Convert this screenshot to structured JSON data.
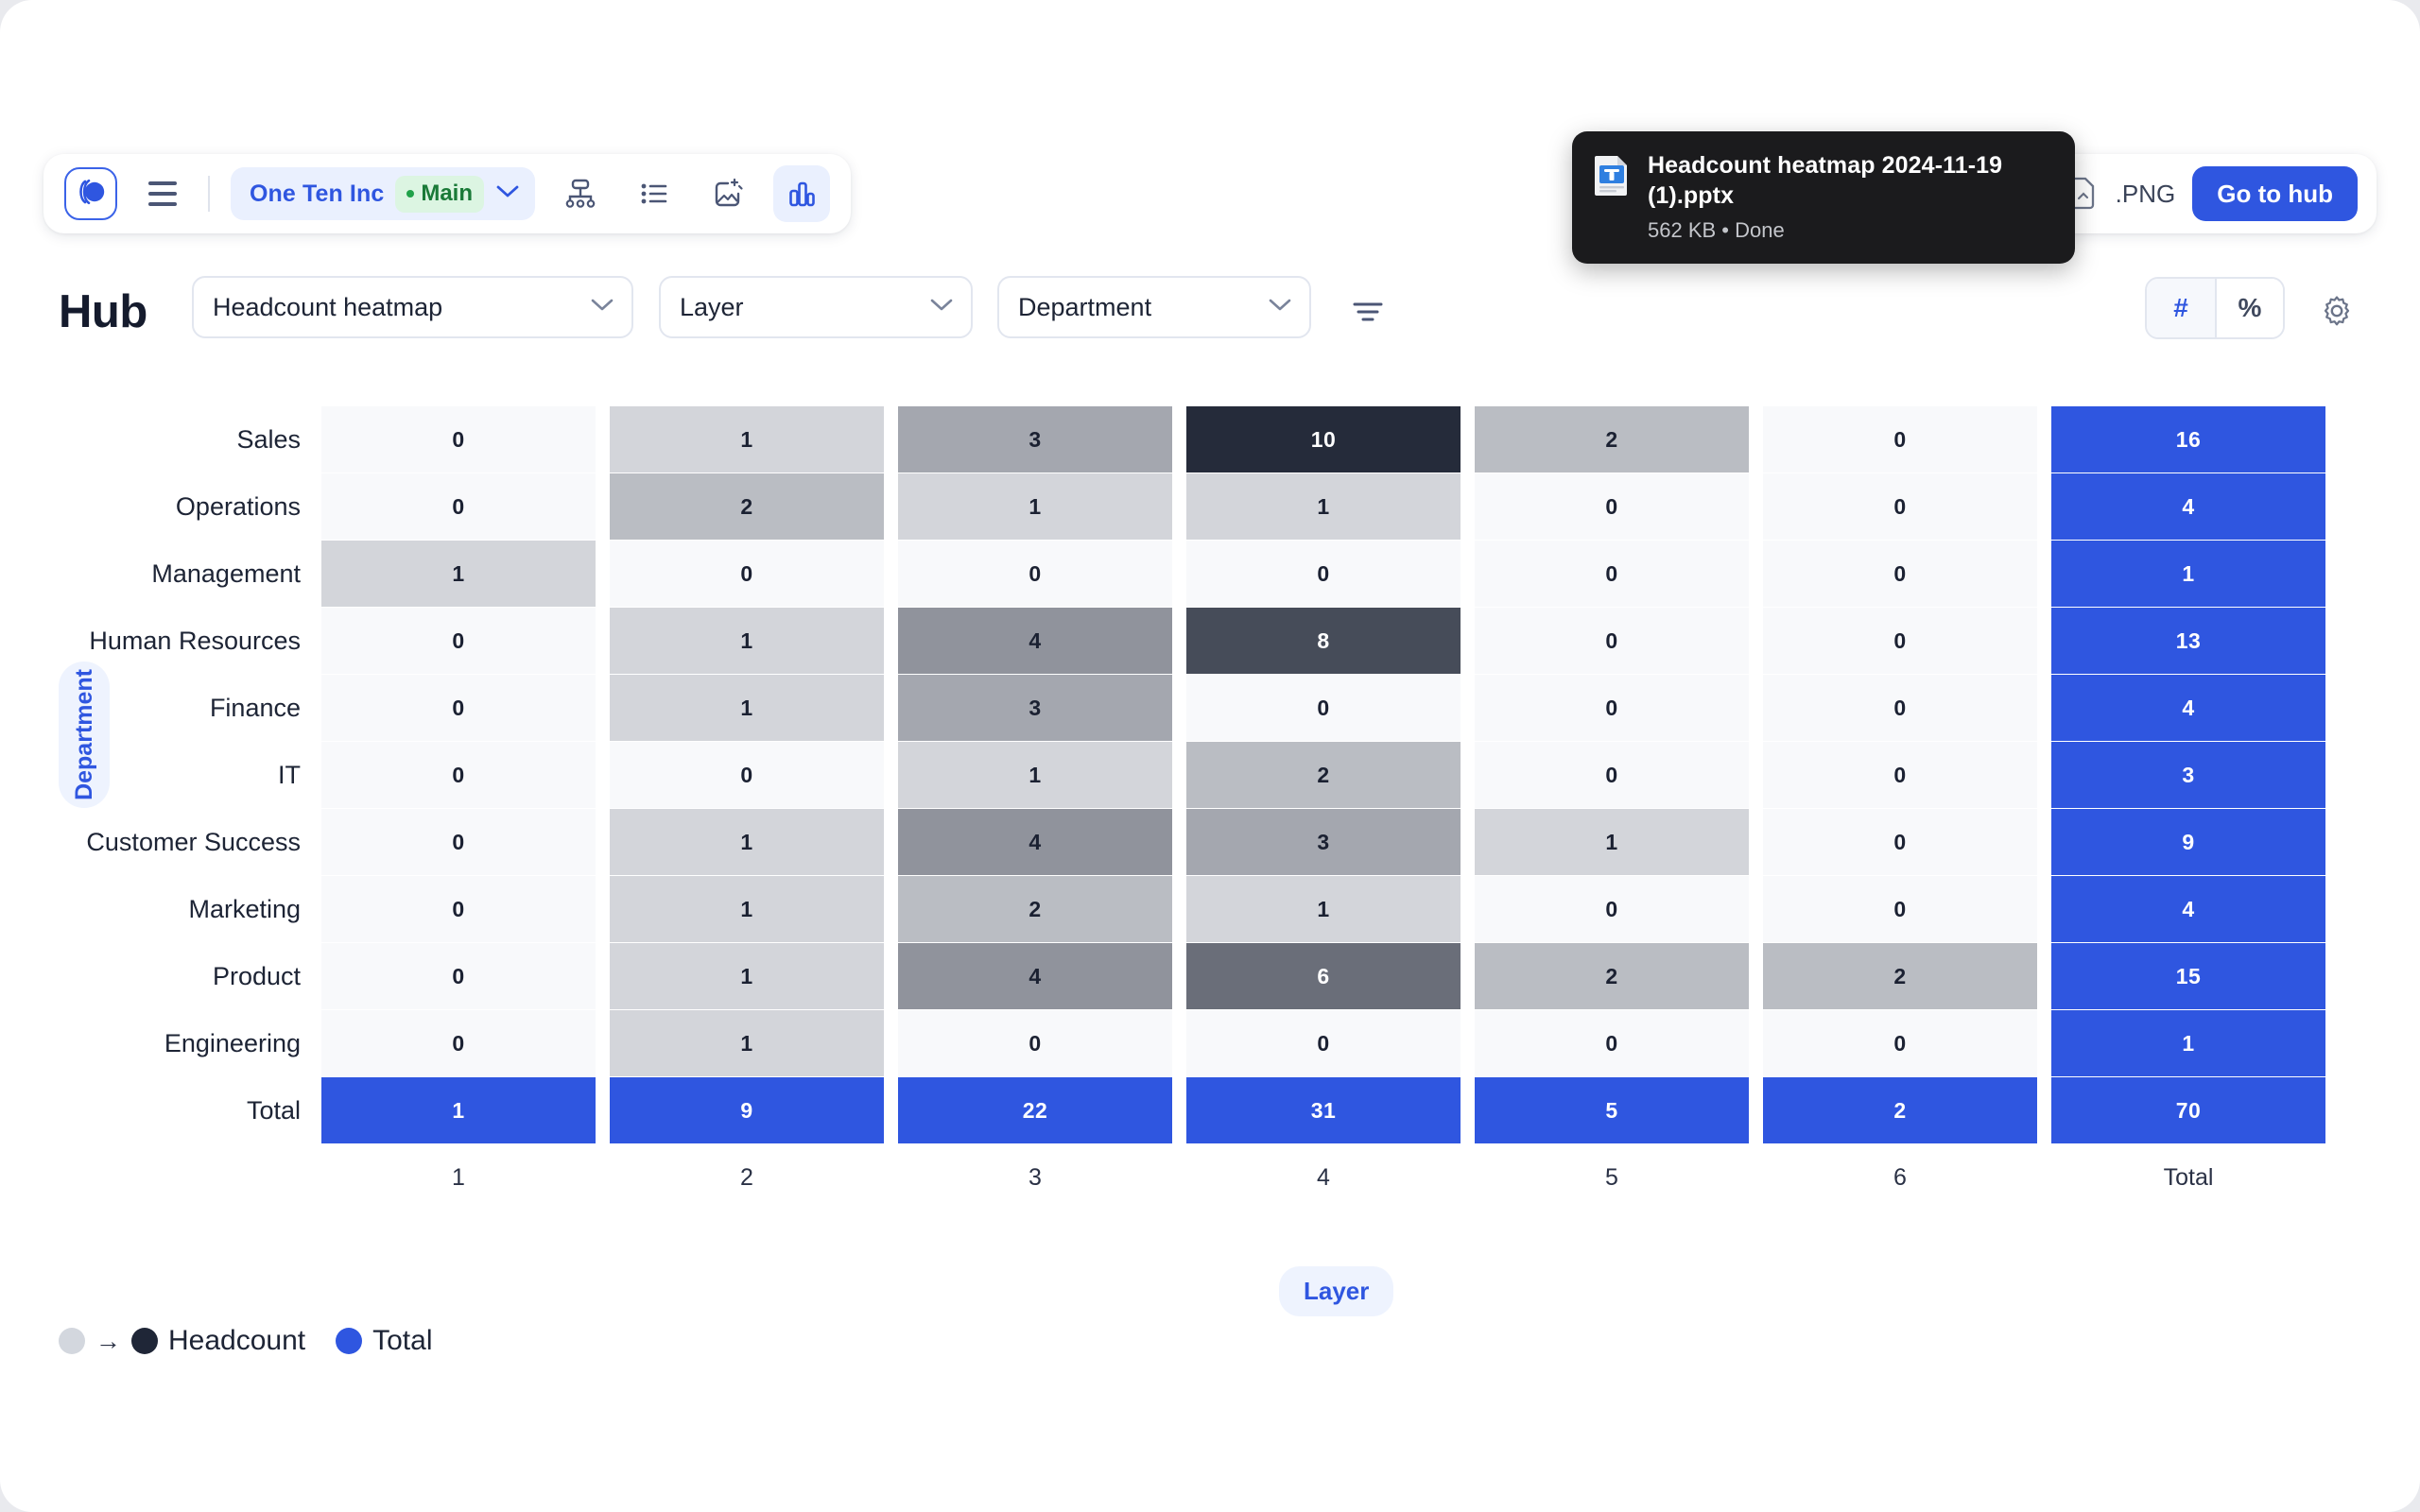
{
  "toolbar": {
    "logo_name": "app-logo",
    "menu_label": "Menu",
    "org_name": "One Ten Inc",
    "branch_name": "Main",
    "icons": [
      {
        "name": "org-chart-icon",
        "label": "Org chart"
      },
      {
        "name": "list-icon",
        "label": "List"
      },
      {
        "name": "image-ai-icon",
        "label": "Image"
      },
      {
        "name": "bar-chart-icon",
        "label": "Charts",
        "active": true
      }
    ]
  },
  "right_bar": {
    "png_label": ".PNG",
    "hub_button": "Go to hub"
  },
  "toast": {
    "file_name": "Headcount heatmap 2024-11-19 (1).pptx",
    "status": "562 KB • Done",
    "icon": "pptx-file-icon"
  },
  "header": {
    "title": "Hub",
    "report_select": "Headcount heatmap",
    "layer_select": "Layer",
    "department_select": "Department",
    "filter_icon": "filter-icon",
    "gear_icon": "gear-icon",
    "mode_hash": "#",
    "mode_percent": "%",
    "mode_active": "#"
  },
  "axis": {
    "y_label": "Department",
    "x_label": "Layer"
  },
  "legend": {
    "gradient_from_color": "#d3d7de",
    "gradient_to_color": "#1f2637",
    "arrow": "→",
    "metric_label": "Headcount",
    "total_color": "#2f56e0",
    "total_label": "Total"
  },
  "colors": {
    "accent": "#2f56e0",
    "heat_min": "#f8f9fb",
    "heat_max": "#2b3243",
    "total": "#2f56e0"
  },
  "chart_data": {
    "type": "heatmap",
    "title": "Headcount heatmap",
    "xlabel": "Layer",
    "ylabel": "Department",
    "columns": [
      "1",
      "2",
      "3",
      "4",
      "5",
      "6"
    ],
    "column_footer": [
      "1",
      "2",
      "3",
      "4",
      "5",
      "6",
      "Total"
    ],
    "total_column_label": "Total",
    "total_row_label": "Total",
    "rows": [
      {
        "label": "Sales",
        "values": [
          0,
          1,
          3,
          10,
          2,
          0
        ],
        "total": 16
      },
      {
        "label": "Operations",
        "values": [
          0,
          2,
          1,
          1,
          0,
          0
        ],
        "total": 4
      },
      {
        "label": "Management",
        "values": [
          1,
          0,
          0,
          0,
          0,
          0
        ],
        "total": 1
      },
      {
        "label": "Human Resources",
        "values": [
          0,
          1,
          4,
          8,
          0,
          0
        ],
        "total": 13
      },
      {
        "label": "Finance",
        "values": [
          0,
          1,
          3,
          0,
          0,
          0
        ],
        "total": 4
      },
      {
        "label": "IT",
        "values": [
          0,
          0,
          1,
          2,
          0,
          0
        ],
        "total": 3
      },
      {
        "label": "Customer Success",
        "values": [
          0,
          1,
          4,
          3,
          1,
          0
        ],
        "total": 9
      },
      {
        "label": "Marketing",
        "values": [
          0,
          1,
          2,
          1,
          0,
          0
        ],
        "total": 4
      },
      {
        "label": "Product",
        "values": [
          0,
          1,
          4,
          6,
          2,
          2
        ],
        "total": 15
      },
      {
        "label": "Engineering",
        "values": [
          0,
          1,
          0,
          0,
          0,
          0
        ],
        "total": 1
      }
    ],
    "totals_row": {
      "label": "Total",
      "values": [
        1,
        9,
        22,
        31,
        5,
        2
      ],
      "total": 70
    },
    "value_max": 10,
    "grid": false,
    "legend_position": "bottom-left"
  }
}
